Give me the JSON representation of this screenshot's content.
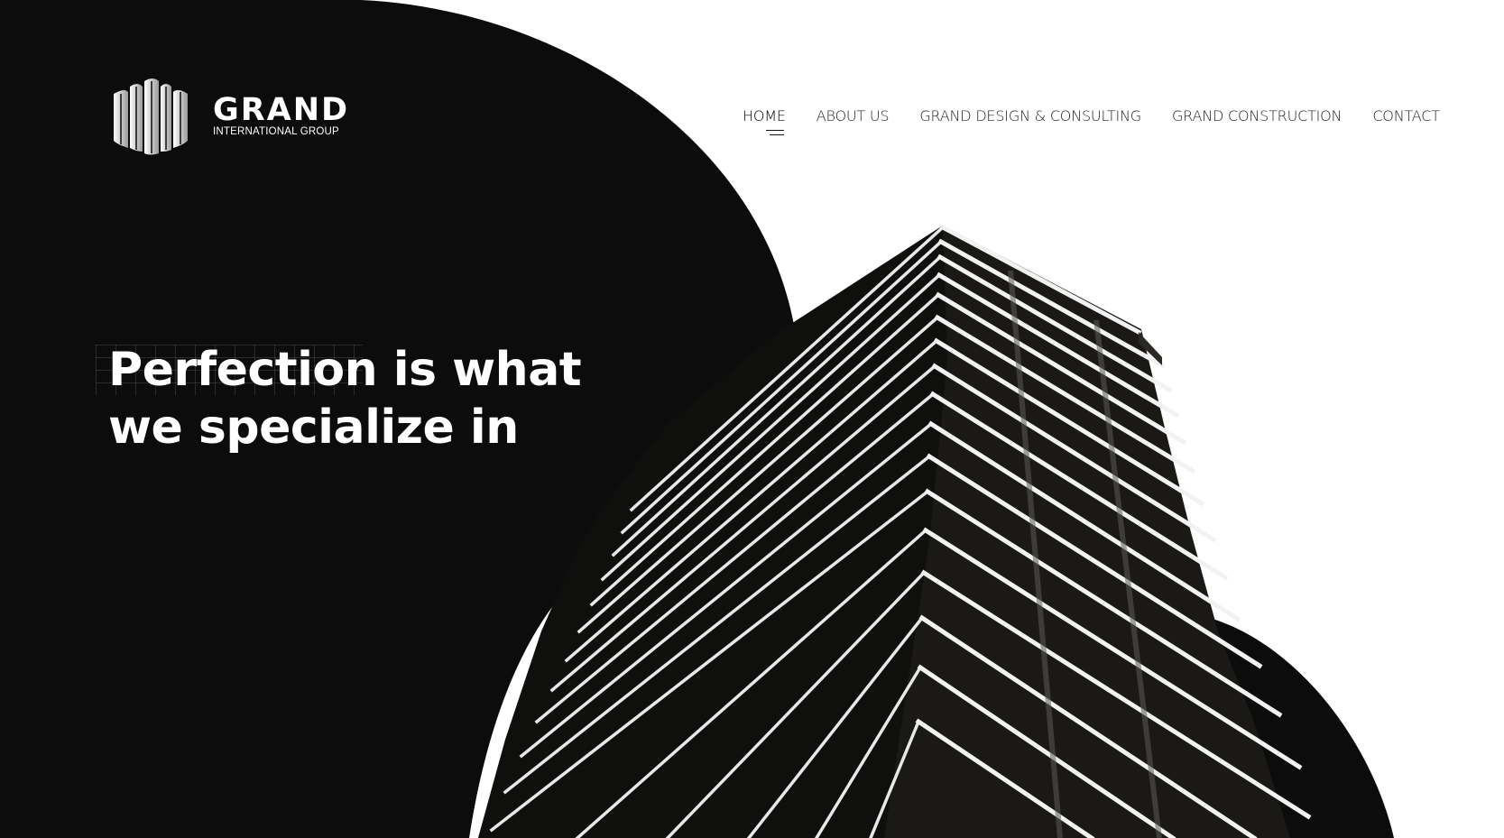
{
  "brand": {
    "name": "GRAND",
    "tagline": "INTERNATIONAL GROUP"
  },
  "nav": {
    "items": [
      {
        "label": "HOME",
        "active": true
      },
      {
        "label": "ABOUT US",
        "active": false
      },
      {
        "label": "GRAND DESIGN & CONSULTING",
        "active": false
      },
      {
        "label": "GRAND CONSTRUCTION",
        "active": false
      },
      {
        "label": "CONTACT",
        "active": false
      }
    ]
  },
  "hero": {
    "headline_line1": "Perfection is what",
    "headline_line2": "we specialize in",
    "image_description_icon": "building-image"
  },
  "colors": {
    "dark": "#0b0c0b",
    "light": "#ffffff",
    "text": "#222222"
  }
}
